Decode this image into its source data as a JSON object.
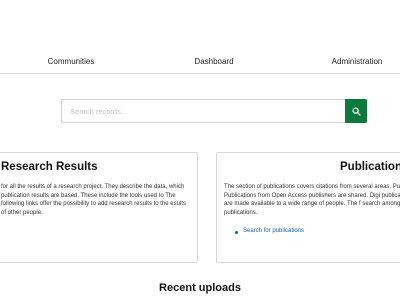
{
  "nav": {
    "communities": "Communities",
    "dashboard": "Dashboard",
    "administration": "Administration"
  },
  "search": {
    "placeholder": "Search records..."
  },
  "research_card": {
    "title": "Research Results",
    "text": "for all the results of a research project. They describe the data, which publication results are based. These include the tools used to The following links offer the possibility to add research results to the esults of other people."
  },
  "publications_card": {
    "title": "Publications",
    "text": "The section of publications covers citations from several areas. Pure. Publications from Open Access publishers are shared. Digi publications are made available to a wide range of people. The f search among publications.",
    "link": "Search for publications"
  },
  "recent_uploads": "Recent uploads",
  "colors": {
    "accent": "#0b7a3b",
    "link": "#1a5fb4"
  }
}
